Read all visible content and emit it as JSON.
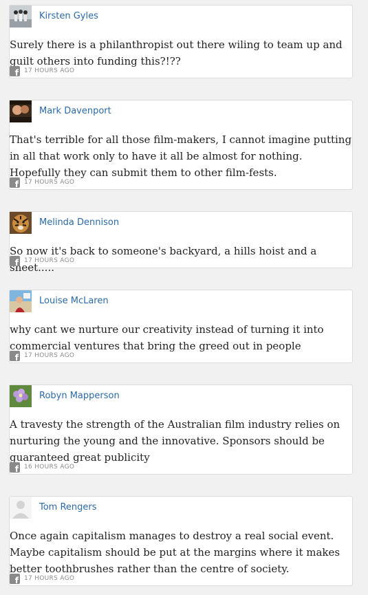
{
  "comments": [
    {
      "author": "Kirsten Gyles",
      "avatar_icon": "avatar-people-photo-icon",
      "text": "Surely there is a philanthropist out there wiling to team up and guilt others into funding this?!??",
      "source_icon": "facebook-icon",
      "time": "17 HOURS AGO"
    },
    {
      "author": "Mark Davenport",
      "avatar_icon": "avatar-couple-photo-icon",
      "text": "That's terrible for all those film-makers, I cannot imagine putting in all that work only to have it all be almost for nothing. Hopefully they can submit them to other film-fests.",
      "source_icon": "facebook-icon",
      "time": "17 HOURS AGO"
    },
    {
      "author": "Melinda Dennison",
      "avatar_icon": "avatar-tiger-photo-icon",
      "text": "So now it's back to someone's backyard, a hills hoist and a sheet.....",
      "source_icon": "facebook-icon",
      "time": "17 HOURS AGO"
    },
    {
      "author": "Louise McLaren",
      "avatar_icon": "avatar-beach-photo-icon",
      "text": "why cant we nurture our creativity instead of turning it into commercial ventures that bring the greed out in people",
      "source_icon": "facebook-icon",
      "time": "17 HOURS AGO"
    },
    {
      "author": "Robyn Mapperson",
      "avatar_icon": "avatar-flower-photo-icon",
      "text": "A travesty the strength of the Australian film industry relies on nurturing the young and the innovative. Sponsors should be guaranteed great publicity",
      "source_icon": "facebook-icon",
      "time": "16 HOURS AGO"
    },
    {
      "author": "Tom Rengers",
      "avatar_icon": "default-avatar-icon",
      "text": "Once again capitalism manages to destroy a real social event. Maybe capitalism should be put at the margins where it makes better toothbrushes rather than the centre of society.",
      "source_icon": "facebook-icon",
      "time": "17 HOURS AGO"
    }
  ],
  "colors": {
    "author_link": "#2a6aa6",
    "comment_text": "#222222",
    "timestamp": "#8b8b8b",
    "card_border": "#dcdcdc"
  }
}
